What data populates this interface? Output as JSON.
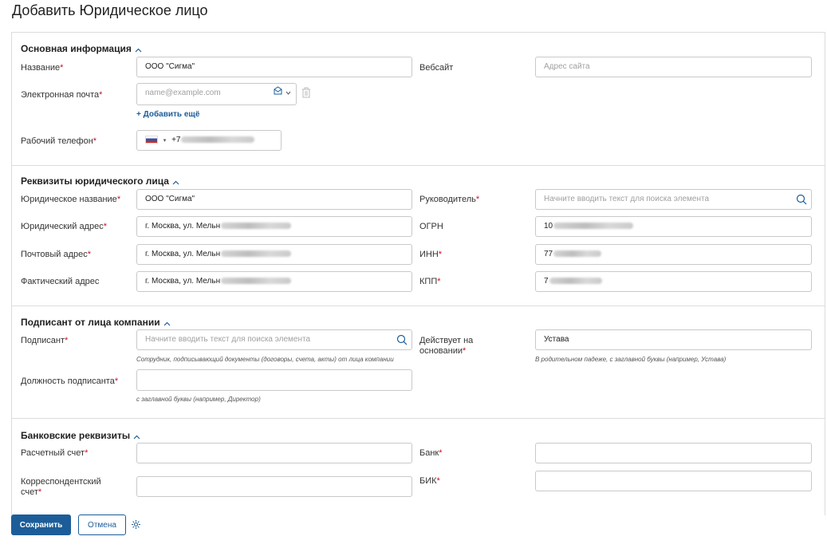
{
  "page_title": "Добавить Юридическое лицо",
  "sections": {
    "basic": {
      "title": "Основная информация",
      "name_label": "Название",
      "name_value": "ООО \"Сигма\"",
      "website_label": "Вебсайт",
      "website_placeholder": "Адрес сайта",
      "email_label": "Электронная почта",
      "email_placeholder": "name@example.com",
      "add_more": "+ Добавить ещё",
      "phone_label": "Рабочий телефон",
      "phone_prefix": "+7"
    },
    "legal": {
      "title": "Реквизиты юридического лица",
      "legal_name_label": "Юридическое название",
      "legal_name_value": "ООО \"Сигма\"",
      "director_label": "Руководитель",
      "director_placeholder": "Начните вводить текст для поиска элемента",
      "legal_address_label": "Юридический адрес",
      "legal_address_value": "г. Москва, ул. Мельн",
      "ogrn_label": "ОГРН",
      "ogrn_value": "10",
      "postal_address_label": "Почтовый адрес",
      "postal_address_value": "г. Москва, ул. Мельн",
      "inn_label": "ИНН",
      "inn_value": "77",
      "actual_address_label": "Фактический адрес",
      "actual_address_value": "г. Москва, ул. Мельн",
      "kpp_label": "КПП",
      "kpp_value": "7"
    },
    "signer": {
      "title": "Подписант от лица компании",
      "signer_label": "Подписант",
      "signer_placeholder": "Начните вводить текст для поиска элемента",
      "signer_hint": "Сотрудник, подписывающий документы (договоры, счета, акты) от лица компании",
      "basis_label_line1": "Действует на",
      "basis_label_line2": "основании",
      "basis_value": "Устава",
      "basis_hint": "В родительном падеже, с заглавной буквы (например, Устава)",
      "position_label": "Должность подписанта",
      "position_hint": "с заглавной буквы (например, Директор)"
    },
    "bank": {
      "title": "Банковские реквизиты",
      "account_label": "Расчетный счет",
      "bank_label": "Банк",
      "corr_label_line1": "Корреспондентский",
      "corr_label_line2": "счет",
      "bik_label": "БИК"
    }
  },
  "footer": {
    "save_label": "Сохранить",
    "cancel_label": "Отмена"
  },
  "colors": {
    "accent": "#1c5d99",
    "required": "#c8102e",
    "border": "#c9c9c9"
  }
}
